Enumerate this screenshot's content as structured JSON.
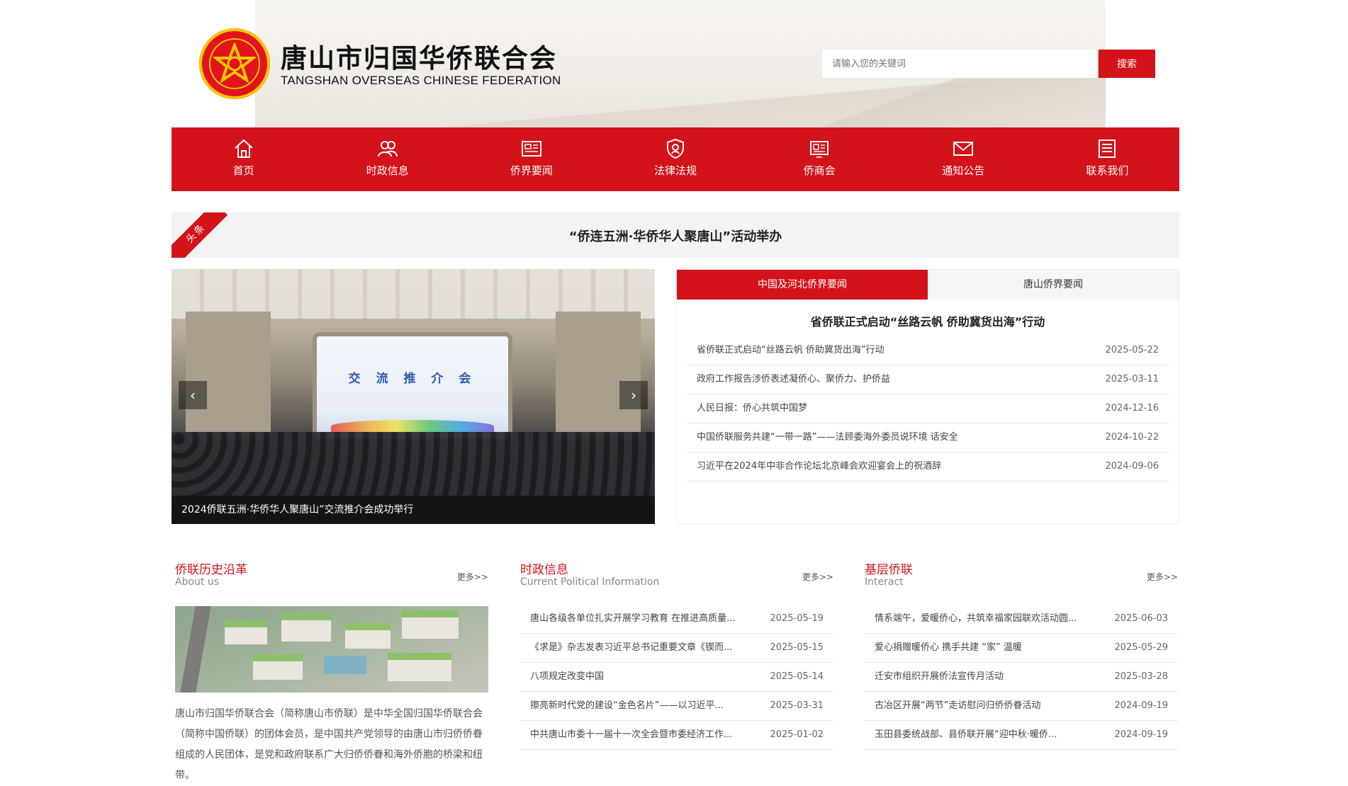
{
  "header": {
    "title": "唐山市归国华侨联合会",
    "subtitle": "TANGSHAN OVERSEAS CHINESE FEDERATION",
    "search_placeholder": "请输入您的关键词",
    "search_button": "搜索"
  },
  "nav": {
    "items": [
      {
        "label": "首页",
        "icon": "home-icon"
      },
      {
        "label": "时政信息",
        "icon": "people-icon"
      },
      {
        "label": "侨界要闻",
        "icon": "newspaper-icon"
      },
      {
        "label": "法律法规",
        "icon": "shield-icon"
      },
      {
        "label": "侨商会",
        "icon": "id-card-icon"
      },
      {
        "label": "通知公告",
        "icon": "mail-icon"
      },
      {
        "label": "联系我们",
        "icon": "contact-list-icon"
      }
    ]
  },
  "headline": {
    "tag": "头条",
    "text": "“侨连五洲·华侨华人聚唐山”活动举办"
  },
  "slider": {
    "screen_text": "交 流 推 介 会",
    "caption": "2024侨联五洲·华侨华人聚唐山”交流推介会成功举行"
  },
  "news": {
    "tabs": [
      "中国及河北侨界要闻",
      "唐山侨界要闻"
    ],
    "featured": "省侨联正式启动“丝路云帆 侨助冀货出海”行动",
    "items": [
      {
        "title": "省侨联正式启动“丝路云帆 侨助冀货出海”行动",
        "date": "2025-05-22"
      },
      {
        "title": "政府工作报告涉侨表述凝侨心、聚侨力、护侨益",
        "date": "2025-03-11"
      },
      {
        "title": "人民日报：侨心共筑中国梦",
        "date": "2024-12-16"
      },
      {
        "title": "中国侨联服务共建“一带一路”——法顾委海外委员说环境 话安全",
        "date": "2024-10-22"
      },
      {
        "title": "习近平在2024年中非合作论坛北京峰会欢迎宴会上的祝酒辞",
        "date": "2024-09-06"
      }
    ]
  },
  "sections": {
    "about": {
      "title": "侨联历史沿革",
      "subtitle": "About us",
      "more": "更多>>",
      "text": "唐山市归国华侨联合会（简称唐山市侨联）是中华全国归国华侨联合会（简称中国侨联）的团体会员，是中国共产党领导的由唐山市归侨侨眷组成的人民团体，是党和政府联系广大归侨侨眷和海外侨胞的桥梁和纽带。"
    },
    "politics": {
      "title": "时政信息",
      "subtitle": "Current Political Information",
      "more": "更多>>",
      "items": [
        {
          "title": "唐山各级各单位扎实开展学习教育 在推进高质量...",
          "date": "2025-05-19"
        },
        {
          "title": "《求是》杂志发表习近平总书记重要文章《锲而...",
          "date": "2025-05-15"
        },
        {
          "title": "八项规定改变中国",
          "date": "2025-05-14"
        },
        {
          "title": "擦亮新时代党的建设“金色名片”——以习近平...",
          "date": "2025-03-31"
        },
        {
          "title": "中共唐山市委十一届十一次全会暨市委经济工作...",
          "date": "2025-01-02"
        }
      ]
    },
    "grassroots": {
      "title": "基层侨联",
      "subtitle": "Interact",
      "more": "更多>>",
      "items": [
        {
          "title": "情系端午，爱暖侨心，共筑幸福家园联欢活动圆...",
          "date": "2025-06-03"
        },
        {
          "title": "爱心捐赠暖侨心 携手共建 “家” 温暖",
          "date": "2025-05-29"
        },
        {
          "title": "迁安市组织开展侨法宣传月活动",
          "date": "2025-03-28"
        },
        {
          "title": "古冶区开展“两节”走访慰问归侨侨眷活动",
          "date": "2024-09-19"
        },
        {
          "title": "玉田县委统战部、县侨联开展“迎中秋·暖侨...",
          "date": "2024-09-19"
        }
      ]
    }
  },
  "colors": {
    "brand_red": "#d3121a",
    "emblem_gold": "#f5c700"
  }
}
